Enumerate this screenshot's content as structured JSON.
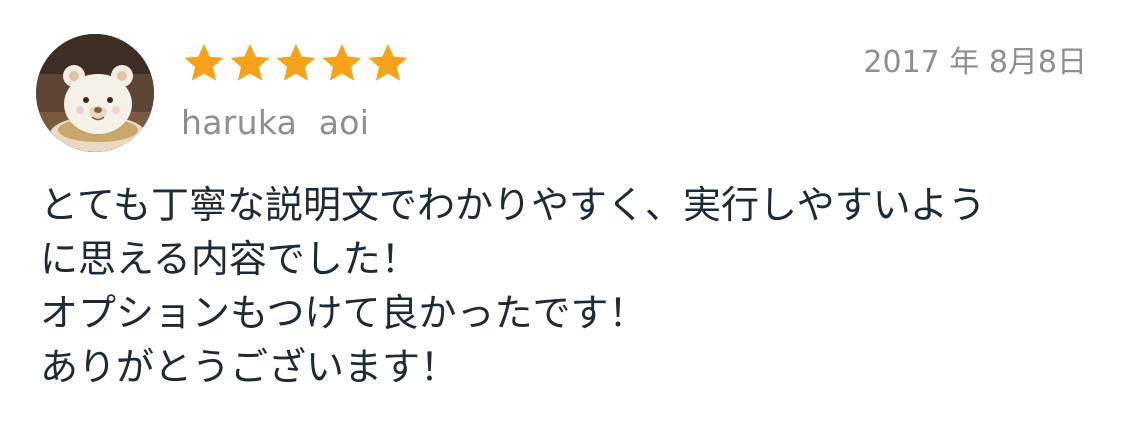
{
  "review": {
    "avatar": {
      "icon": "bear-latte-art-avatar"
    },
    "rating": {
      "stars_filled": 5,
      "stars_total": 5,
      "star_color": "#f7a21b"
    },
    "username": "haruka  aoi",
    "date": "2017 年 8月8日",
    "body_lines": [
      "とても丁寧な説明文でわかりやすく、実行しやすいよう",
      "に思える内容でした！",
      "オプションもつけて良かったです！",
      "ありがとうございます！"
    ]
  },
  "colors": {
    "text_primary": "#1e2a36",
    "text_secondary": "#8f8f8f",
    "background": "#ffffff"
  }
}
